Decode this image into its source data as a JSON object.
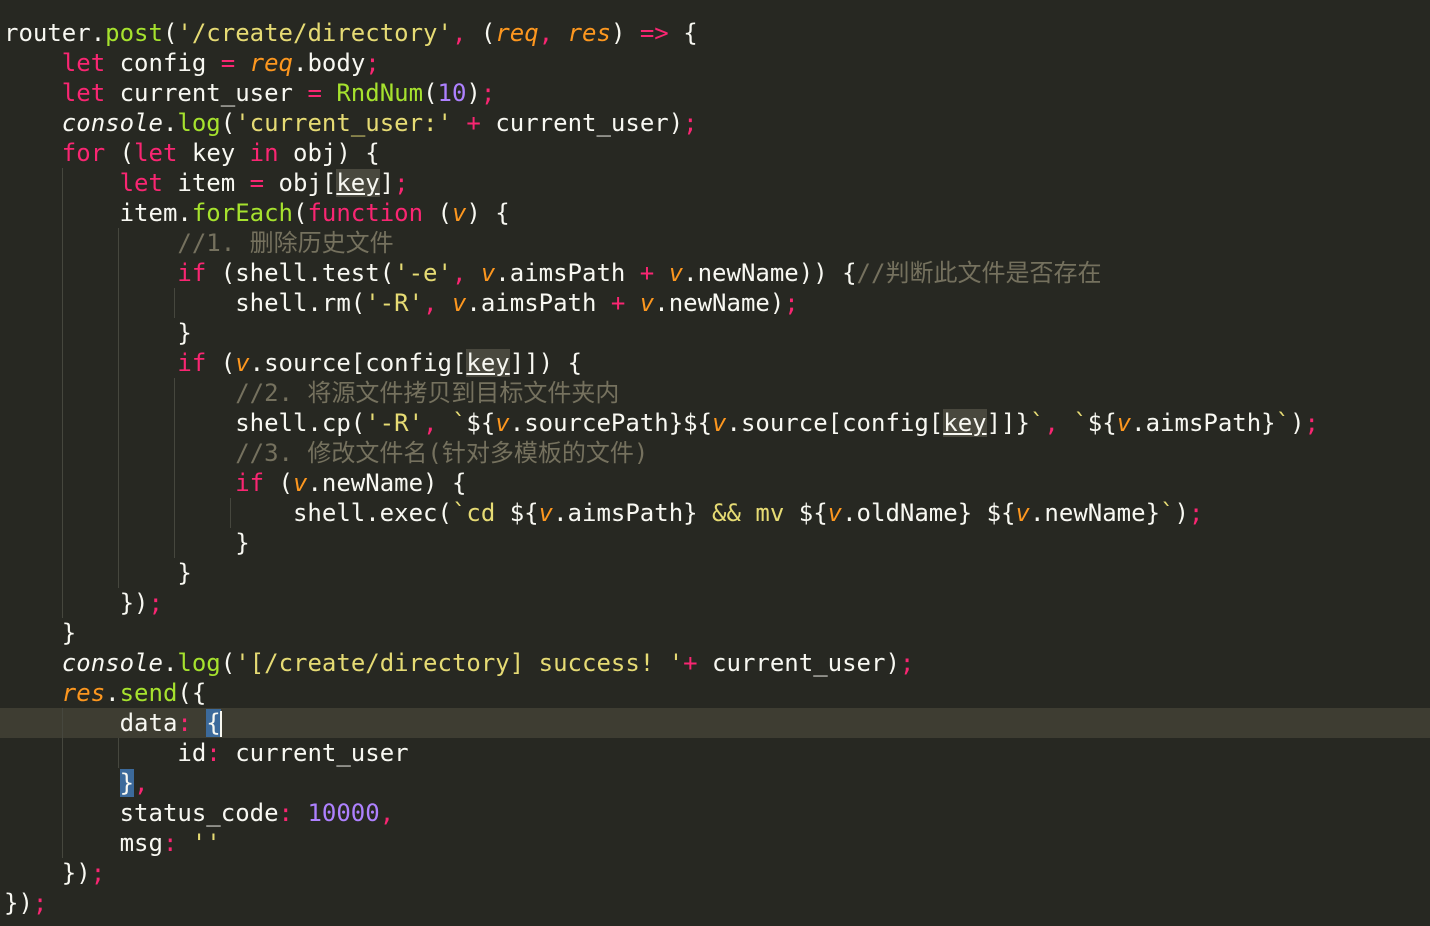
{
  "editor": {
    "theme": "monokai",
    "colors": {
      "background": "#272822",
      "active_line": "#3E3D32",
      "keyword": "#F92672",
      "function": "#A6E22E",
      "string": "#E6DB74",
      "number": "#AE81FF",
      "parameter": "#FD971F",
      "comment": "#75715E",
      "text": "#F8F8F2"
    },
    "lines": [
      {
        "indent": 0,
        "tokens": [
          [
            "plain",
            "router."
          ],
          [
            "fn",
            "post"
          ],
          [
            "plain",
            "("
          ],
          [
            "str",
            "'/create/directory'"
          ],
          [
            "punc",
            ", "
          ],
          [
            "plain",
            "("
          ],
          [
            "param",
            "req"
          ],
          [
            "punc",
            ", "
          ],
          [
            "param",
            "res"
          ],
          [
            "plain",
            ") "
          ],
          [
            "kw",
            "=>"
          ],
          [
            "plain",
            " {"
          ]
        ]
      },
      {
        "indent": 1,
        "tokens": [
          [
            "kw",
            "let"
          ],
          [
            "plain",
            " config "
          ],
          [
            "kw",
            "="
          ],
          [
            "plain",
            " "
          ],
          [
            "param",
            "req"
          ],
          [
            "plain",
            ".body"
          ],
          [
            "punc",
            ";"
          ]
        ]
      },
      {
        "indent": 1,
        "tokens": [
          [
            "kw",
            "let"
          ],
          [
            "plain",
            " current_user "
          ],
          [
            "kw",
            "="
          ],
          [
            "plain",
            " "
          ],
          [
            "fn",
            "RndNum"
          ],
          [
            "plain",
            "("
          ],
          [
            "num",
            "10"
          ],
          [
            "plain",
            ")"
          ],
          [
            "punc",
            ";"
          ]
        ]
      },
      {
        "indent": 1,
        "tokens": [
          [
            "italic",
            "console"
          ],
          [
            "plain",
            "."
          ],
          [
            "fn",
            "log"
          ],
          [
            "plain",
            "("
          ],
          [
            "str",
            "'current_user:'"
          ],
          [
            "plain",
            " "
          ],
          [
            "kw",
            "+"
          ],
          [
            "plain",
            " current_user)"
          ],
          [
            "punc",
            ";"
          ]
        ]
      },
      {
        "indent": 1,
        "tokens": [
          [
            "kw",
            "for"
          ],
          [
            "plain",
            " ("
          ],
          [
            "kw",
            "let"
          ],
          [
            "plain",
            " key "
          ],
          [
            "kw",
            "in"
          ],
          [
            "plain",
            " obj) {"
          ]
        ]
      },
      {
        "indent": 2,
        "tokens": [
          [
            "kw",
            "let"
          ],
          [
            "plain",
            " item "
          ],
          [
            "kw",
            "="
          ],
          [
            "plain",
            " obj["
          ],
          [
            "hlkey",
            "key"
          ],
          [
            "plain",
            "]"
          ],
          [
            "punc",
            ";"
          ]
        ]
      },
      {
        "indent": 2,
        "tokens": [
          [
            "plain",
            "item."
          ],
          [
            "fn",
            "forEach"
          ],
          [
            "plain",
            "("
          ],
          [
            "kw",
            "function"
          ],
          [
            "plain",
            " ("
          ],
          [
            "param",
            "v"
          ],
          [
            "plain",
            ") {"
          ]
        ]
      },
      {
        "indent": 3,
        "tokens": [
          [
            "comment",
            "//1. 删除历史文件"
          ]
        ]
      },
      {
        "indent": 3,
        "tokens": [
          [
            "kw",
            "if"
          ],
          [
            "plain",
            " (shell.test("
          ],
          [
            "str",
            "'-e'"
          ],
          [
            "punc",
            ", "
          ],
          [
            "param",
            "v"
          ],
          [
            "plain",
            ".aimsPath "
          ],
          [
            "kw",
            "+"
          ],
          [
            "plain",
            " "
          ],
          [
            "param",
            "v"
          ],
          [
            "plain",
            ".newName)) {"
          ],
          [
            "comment",
            "//判断此文件是否存在"
          ]
        ]
      },
      {
        "indent": 4,
        "tokens": [
          [
            "plain",
            "shell.rm("
          ],
          [
            "str",
            "'-R'"
          ],
          [
            "punc",
            ", "
          ],
          [
            "param",
            "v"
          ],
          [
            "plain",
            ".aimsPath "
          ],
          [
            "kw",
            "+"
          ],
          [
            "plain",
            " "
          ],
          [
            "param",
            "v"
          ],
          [
            "plain",
            ".newName)"
          ],
          [
            "punc",
            ";"
          ]
        ]
      },
      {
        "indent": 3,
        "tokens": [
          [
            "plain",
            "}"
          ]
        ]
      },
      {
        "indent": 3,
        "tokens": [
          [
            "kw",
            "if"
          ],
          [
            "plain",
            " ("
          ],
          [
            "param",
            "v"
          ],
          [
            "plain",
            ".source[config["
          ],
          [
            "hlkey",
            "key"
          ],
          [
            "plain",
            "]]) {"
          ]
        ]
      },
      {
        "indent": 4,
        "tokens": [
          [
            "comment",
            "//2. 将源文件拷贝到目标文件夹内"
          ]
        ]
      },
      {
        "indent": 4,
        "tokens": [
          [
            "plain",
            "shell.cp("
          ],
          [
            "str",
            "'-R'"
          ],
          [
            "punc",
            ", "
          ],
          [
            "str",
            "`"
          ],
          [
            "plain",
            "${"
          ],
          [
            "param",
            "v"
          ],
          [
            "plain",
            ".sourcePath}${"
          ],
          [
            "param",
            "v"
          ],
          [
            "plain",
            ".source[config["
          ],
          [
            "hlkey",
            "key"
          ],
          [
            "plain",
            "]]}"
          ],
          [
            "str",
            "`"
          ],
          [
            "punc",
            ", "
          ],
          [
            "str",
            "`"
          ],
          [
            "plain",
            "${"
          ],
          [
            "param",
            "v"
          ],
          [
            "plain",
            ".aimsPath}"
          ],
          [
            "str",
            "`"
          ],
          [
            "plain",
            ")"
          ],
          [
            "punc",
            ";"
          ]
        ]
      },
      {
        "indent": 4,
        "tokens": [
          [
            "comment",
            "//3. 修改文件名(针对多模板的文件)"
          ]
        ]
      },
      {
        "indent": 4,
        "tokens": [
          [
            "kw",
            "if"
          ],
          [
            "plain",
            " ("
          ],
          [
            "param",
            "v"
          ],
          [
            "plain",
            ".newName) {"
          ]
        ]
      },
      {
        "indent": 5,
        "tokens": [
          [
            "plain",
            "shell.exec("
          ],
          [
            "str",
            "`cd "
          ],
          [
            "plain",
            "${"
          ],
          [
            "param",
            "v"
          ],
          [
            "plain",
            ".aimsPath}"
          ],
          [
            "str",
            " && mv "
          ],
          [
            "plain",
            "${"
          ],
          [
            "param",
            "v"
          ],
          [
            "plain",
            ".oldName}"
          ],
          [
            "str",
            " "
          ],
          [
            "plain",
            "${"
          ],
          [
            "param",
            "v"
          ],
          [
            "plain",
            ".newName}"
          ],
          [
            "str",
            "`"
          ],
          [
            "plain",
            ")"
          ],
          [
            "punc",
            ";"
          ]
        ]
      },
      {
        "indent": 4,
        "tokens": [
          [
            "plain",
            "}"
          ]
        ]
      },
      {
        "indent": 3,
        "tokens": [
          [
            "plain",
            "}"
          ]
        ]
      },
      {
        "indent": 2,
        "tokens": [
          [
            "plain",
            "})"
          ],
          [
            "punc",
            ";"
          ]
        ]
      },
      {
        "indent": 1,
        "tokens": [
          [
            "plain",
            "}"
          ]
        ]
      },
      {
        "indent": 1,
        "tokens": [
          [
            "italic",
            "console"
          ],
          [
            "plain",
            "."
          ],
          [
            "fn",
            "log"
          ],
          [
            "plain",
            "("
          ],
          [
            "str",
            "'[/create/directory] success! '"
          ],
          [
            "kw",
            "+"
          ],
          [
            "plain",
            " current_user)"
          ],
          [
            "punc",
            ";"
          ]
        ]
      },
      {
        "indent": 1,
        "tokens": [
          [
            "param",
            "res"
          ],
          [
            "plain",
            "."
          ],
          [
            "fn",
            "send"
          ],
          [
            "plain",
            "({"
          ]
        ]
      },
      {
        "indent": 2,
        "active": true,
        "tokens": [
          [
            "plain",
            "data"
          ],
          [
            "punc",
            ": "
          ],
          [
            "bracket",
            "{"
          ],
          [
            "cursor",
            ""
          ]
        ]
      },
      {
        "indent": 3,
        "tokens": [
          [
            "plain",
            "id"
          ],
          [
            "punc",
            ": "
          ],
          [
            "plain",
            "current_user"
          ]
        ]
      },
      {
        "indent": 2,
        "tokens": [
          [
            "bracket",
            "}"
          ],
          [
            "punc",
            ","
          ]
        ]
      },
      {
        "indent": 2,
        "tokens": [
          [
            "plain",
            "status_code"
          ],
          [
            "punc",
            ": "
          ],
          [
            "num",
            "10000"
          ],
          [
            "punc",
            ","
          ]
        ]
      },
      {
        "indent": 2,
        "tokens": [
          [
            "plain",
            "msg"
          ],
          [
            "punc",
            ": "
          ],
          [
            "str",
            "''"
          ]
        ]
      },
      {
        "indent": 1,
        "tokens": [
          [
            "plain",
            "})"
          ],
          [
            "punc",
            ";"
          ]
        ]
      },
      {
        "indent": 0,
        "tokens": [
          [
            "plain",
            "})"
          ],
          [
            "punc",
            ";"
          ]
        ]
      }
    ]
  }
}
